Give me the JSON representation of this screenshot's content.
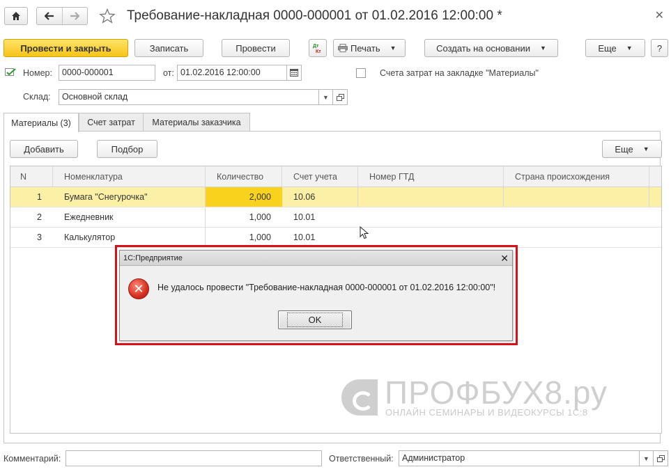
{
  "window": {
    "title": "Требование-накладная 0000-000001 от 01.02.2016 12:00:00 *"
  },
  "toolbar": {
    "post_close": "Провести и закрыть",
    "save": "Записать",
    "post": "Провести",
    "print": "Печать",
    "create_based": "Создать на основании",
    "more": "Еще",
    "help": "?"
  },
  "header": {
    "number_label": "Номер:",
    "number_value": "0000-000001",
    "date_label": "от:",
    "date_value": "01.02.2016 12:00:00",
    "cost_accounts_checkbox_label": "Счета затрат на закладке \"Материалы\"",
    "cost_accounts_checked": false,
    "warehouse_label": "Склад:",
    "warehouse_value": "Основной склад"
  },
  "tabs": [
    {
      "label": "Материалы (3)",
      "active": true
    },
    {
      "label": "Счет затрат",
      "active": false
    },
    {
      "label": "Материалы заказчика",
      "active": false
    }
  ],
  "table_toolbar": {
    "add": "Добавить",
    "pick": "Подбор",
    "more": "Еще"
  },
  "table": {
    "columns": [
      "N",
      "Номенклатура",
      "Количество",
      "Счет учета",
      "Номер ГТД",
      "Страна происхождения"
    ],
    "rows": [
      {
        "n": "1",
        "item": "Бумага \"Снегурочка\"",
        "qty": "2,000",
        "account": "10.06",
        "gtd": "",
        "country": ""
      },
      {
        "n": "2",
        "item": "Ежедневник",
        "qty": "1,000",
        "account": "10.01",
        "gtd": "",
        "country": ""
      },
      {
        "n": "3",
        "item": "Калькулятор",
        "qty": "1,000",
        "account": "10.01",
        "gtd": "",
        "country": ""
      }
    ]
  },
  "dialog": {
    "title": "1С:Предприятие",
    "message": "Не удалось провести \"Требование-накладная 0000-000001 от 01.02.2016 12:00:00\"!",
    "ok": "OK"
  },
  "footer": {
    "comment_label": "Комментарий:",
    "comment_value": "",
    "responsible_label": "Ответственный:",
    "responsible_value": "Администратор"
  },
  "watermark": {
    "title": "ПРОФБУХ8.ру",
    "subtitle": "ОНЛАЙН СЕМИНАРЫ И ВИДЕОКУРСЫ 1С:8"
  },
  "colors": {
    "primary_button": "#f6c418",
    "selected_row": "#fbf0a6",
    "selected_cell": "#f8d21c",
    "dialog_highlight": "#d8101a",
    "error_icon": "#d6301f"
  },
  "icons": {
    "home": "home-icon",
    "back": "arrow-left-icon",
    "forward": "arrow-right-icon",
    "favorite": "star-icon",
    "close": "close-icon",
    "dtkt": "dt-kt-icon",
    "printer": "printer-icon",
    "calendar": "calendar-icon",
    "error": "error-icon"
  }
}
